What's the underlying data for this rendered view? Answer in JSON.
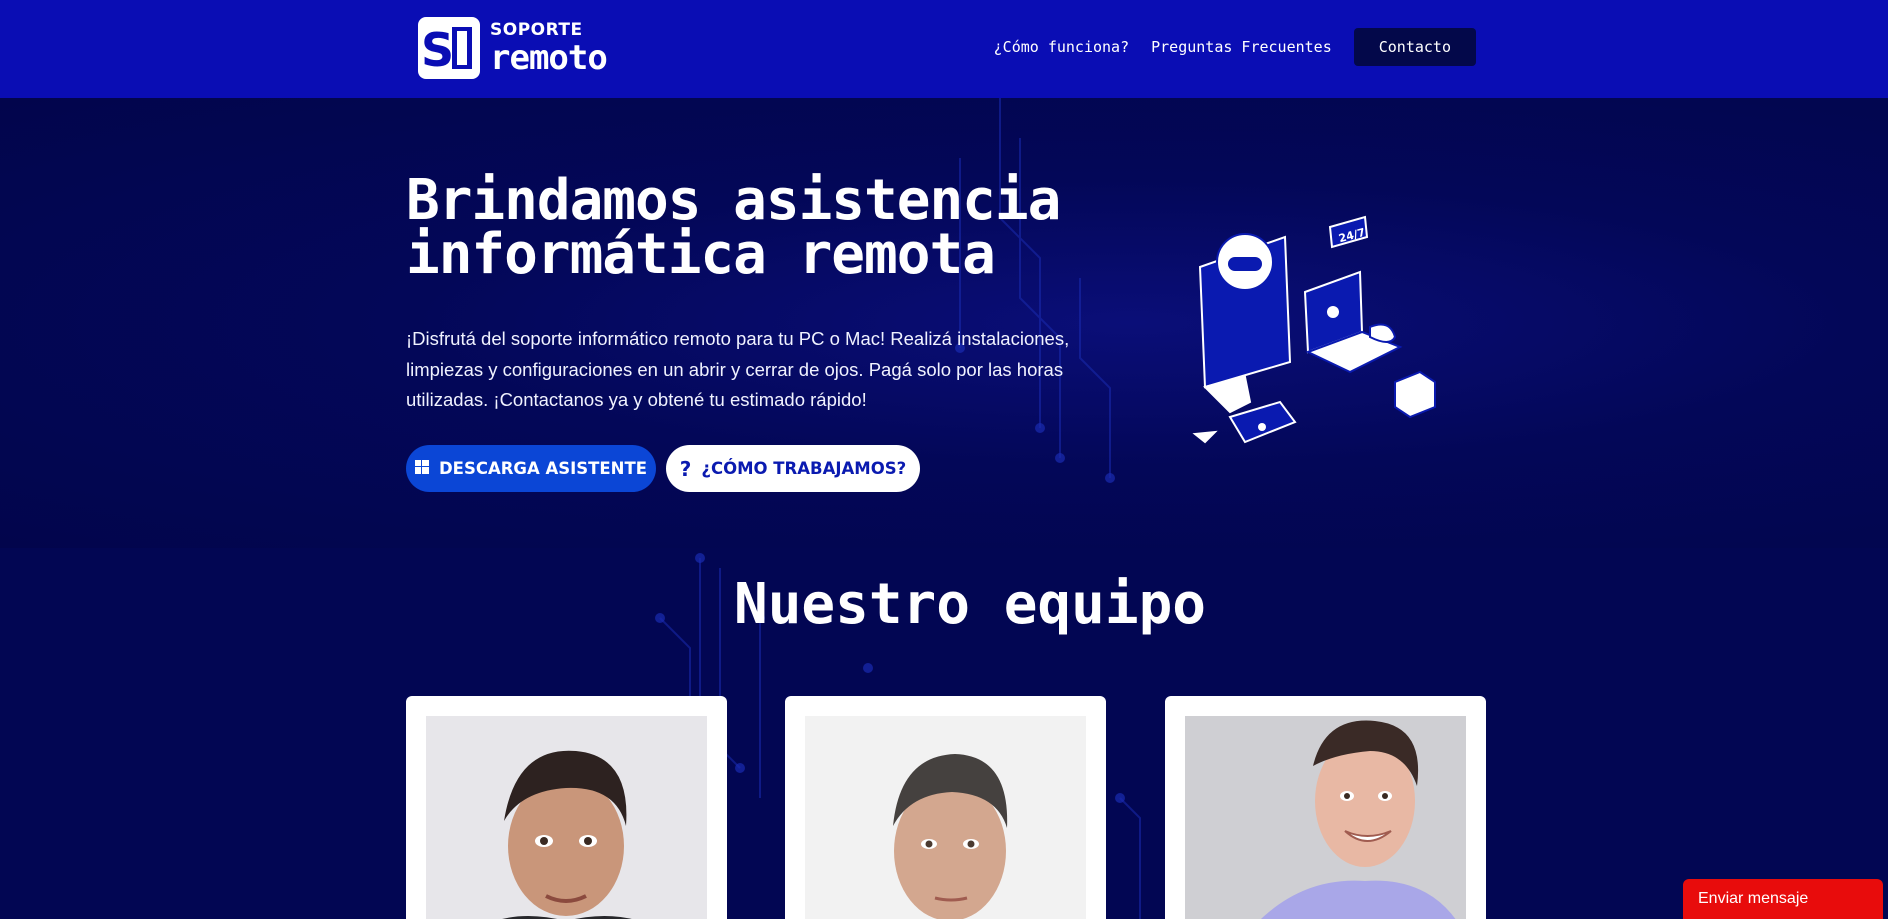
{
  "header": {
    "logo_small": "SOPORTE",
    "logo_big": "remoto",
    "nav": {
      "how": "¿Cómo funciona?",
      "faq": "Preguntas Frecuentes",
      "contact": "Contacto"
    }
  },
  "hero": {
    "title_line1": "Brindamos asistencia",
    "title_line2": "informática remota",
    "description": "¡Disfrutá del soporte informático remoto para tu PC o Mac! Realizá instalaciones, limpiezas y configuraciones en un abrir y cerrar de ojos. Pagá solo por las horas utilizadas. ¡Contactanos ya y obtené tu estimado rápido!",
    "download_label": "DESCARGA ASISTENTE",
    "how_label": "¿CÓMO TRABAJAMOS?",
    "badge": "24/7"
  },
  "team": {
    "title": "Nuestro equipo",
    "members": [
      {
        "icon": "person-photo"
      },
      {
        "icon": "person-photo"
      },
      {
        "icon": "person-photo"
      }
    ]
  },
  "chat": {
    "label": "Enviar mensaje"
  },
  "colors": {
    "header_bg": "#0a0db4",
    "page_bg": "#020653",
    "primary_button": "#0b46d6",
    "chat_button": "#e80c0c"
  }
}
